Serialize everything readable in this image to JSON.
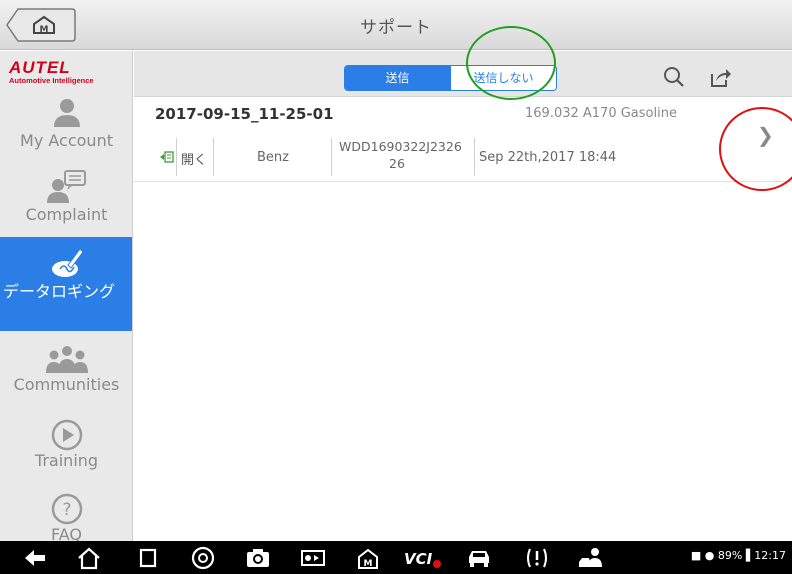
{
  "header": {
    "title": "サポート"
  },
  "sidebar": {
    "logo": {
      "brand": "AUTEL",
      "tagline": "Automotive Intelligence"
    },
    "items": [
      {
        "label": "My Account",
        "icon": "person-icon"
      },
      {
        "label": "Complaint",
        "icon": "person-chat-icon"
      },
      {
        "label": "データロギング",
        "icon": "pen-sign-icon",
        "active": true
      },
      {
        "label": "Communities",
        "icon": "group-icon"
      },
      {
        "label": "Training",
        "icon": "play-circle-icon"
      },
      {
        "label": "FAQ",
        "icon": "question-circle-icon"
      }
    ]
  },
  "toolbar": {
    "segment": {
      "sent": "送信",
      "unsent": "送信しない",
      "selected": "sent"
    },
    "search_icon": "search-icon",
    "share_icon": "share-icon"
  },
  "record": {
    "title": "2017-09-15_11-25-01",
    "model": "169.032 A170 Gasoline",
    "open_label": "開く",
    "make": "Benz",
    "vin_line1": "WDD1690322J2326",
    "vin_line2": "26",
    "date": "Sep 22th,2017 18:44"
  },
  "statusbar": {
    "battery": "89%",
    "time": "12:17"
  },
  "colors": {
    "accent": "#2a7ee6",
    "brand": "#d0021b",
    "annotation_green": "#1fa01f",
    "annotation_red": "#e01010"
  }
}
